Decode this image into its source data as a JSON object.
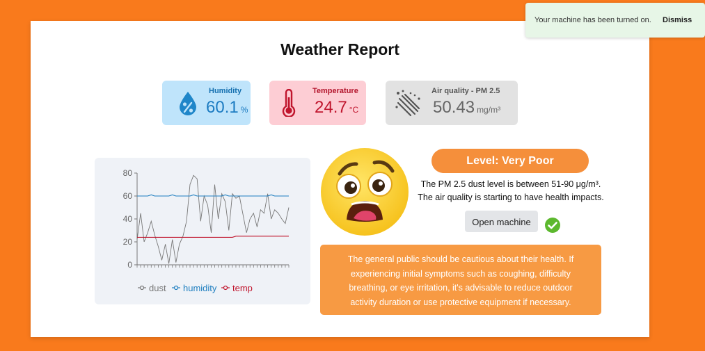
{
  "header": {
    "title": "Weather Report"
  },
  "stats": {
    "humidity": {
      "label": "Humidity",
      "value": "60.1",
      "unit": "%",
      "icon": "water-percent-icon",
      "color": "#1d7cc2"
    },
    "temperature": {
      "label": "Temperature",
      "value": "24.7",
      "unit": "°C",
      "icon": "thermometer-icon",
      "color": "#c0152d"
    },
    "air_quality": {
      "label": "Air quality - PM 2.5",
      "value": "50.43",
      "unit": "mg/m³",
      "icon": "dust-particles-icon",
      "color": "#666666"
    }
  },
  "status": {
    "level": "Level: Very Poor",
    "line1": "The PM 2.5 dust level is between 51-90 μg/m³.",
    "line2": "The air quality is starting to have health impacts.",
    "emoji_icon": "anxious-face-icon",
    "check_icon": "check-circle-icon",
    "advice": "The general public should be cautious about their health. If experiencing initial symptoms such as coughing, difficulty breathing, or eye irritation, it's advisable to reduce outdoor activity duration or use protective equipment if necessary."
  },
  "actions": {
    "open_machine": "Open machine"
  },
  "toast": {
    "message": "Your machine has been turned on.",
    "dismiss": "Dismiss"
  },
  "chart_data": {
    "type": "line",
    "ylim": [
      0,
      80
    ],
    "yticks": [
      "0",
      "20",
      "40",
      "60",
      "80"
    ],
    "legend_position": "bottom",
    "series": [
      {
        "name": "dust",
        "color": "#777777",
        "values": [
          22,
          45,
          20,
          28,
          38,
          26,
          16,
          4,
          18,
          1,
          22,
          2,
          18,
          25,
          38,
          70,
          78,
          75,
          38,
          60,
          52,
          28,
          70,
          40,
          62,
          55,
          30,
          62,
          58,
          60,
          44,
          28,
          40,
          45,
          33,
          48,
          45,
          62,
          40,
          48,
          45,
          40,
          36,
          50
        ]
      },
      {
        "name": "humidity",
        "color": "#1f7fc0",
        "values": [
          60,
          60,
          60,
          60,
          61,
          60,
          60,
          60,
          60,
          60,
          61,
          60,
          60,
          60,
          60,
          60,
          61,
          60,
          60,
          60,
          60,
          60,
          60,
          60,
          60,
          61,
          60,
          60,
          60,
          60,
          60,
          60,
          60,
          60,
          60,
          60,
          60,
          60,
          61,
          60,
          60,
          60,
          60,
          60
        ]
      },
      {
        "name": "temp",
        "color": "#c0152d",
        "values": [
          24,
          24,
          24,
          24,
          24,
          24,
          24,
          24,
          24,
          24,
          24,
          24,
          24,
          24,
          24,
          24,
          24,
          24,
          24,
          24,
          24,
          24,
          24,
          24,
          24,
          24,
          24,
          24,
          25,
          25,
          25,
          25,
          25,
          25,
          25,
          25,
          25,
          25,
          25,
          25,
          25,
          25,
          25,
          25
        ]
      }
    ]
  }
}
